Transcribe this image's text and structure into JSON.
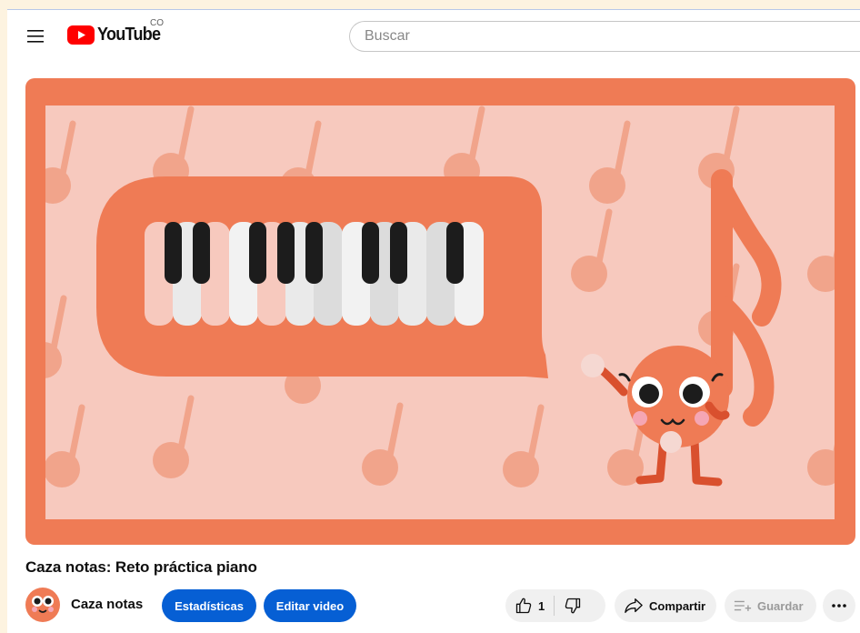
{
  "header": {
    "logo_text": "YouTube",
    "country_code": "CO",
    "search_placeholder": "Buscar"
  },
  "video": {
    "title": "Caza notas: Reto práctica piano",
    "channel_name": "Caza notas"
  },
  "actions": {
    "stats_label": "Estadísticas",
    "edit_label": "Editar video",
    "like_count": "1",
    "share_label": "Compartir",
    "save_label": "Guardar"
  },
  "colors": {
    "accent_blue": "#065fd4",
    "thumbnail_frame": "#ef7b55",
    "thumbnail_bg": "#f7c9be",
    "youtube_red": "#ff0000"
  },
  "icons": [
    "menu-icon",
    "youtube-logo-icon",
    "like-icon",
    "dislike-icon",
    "share-icon",
    "save-icon",
    "more-icon"
  ]
}
